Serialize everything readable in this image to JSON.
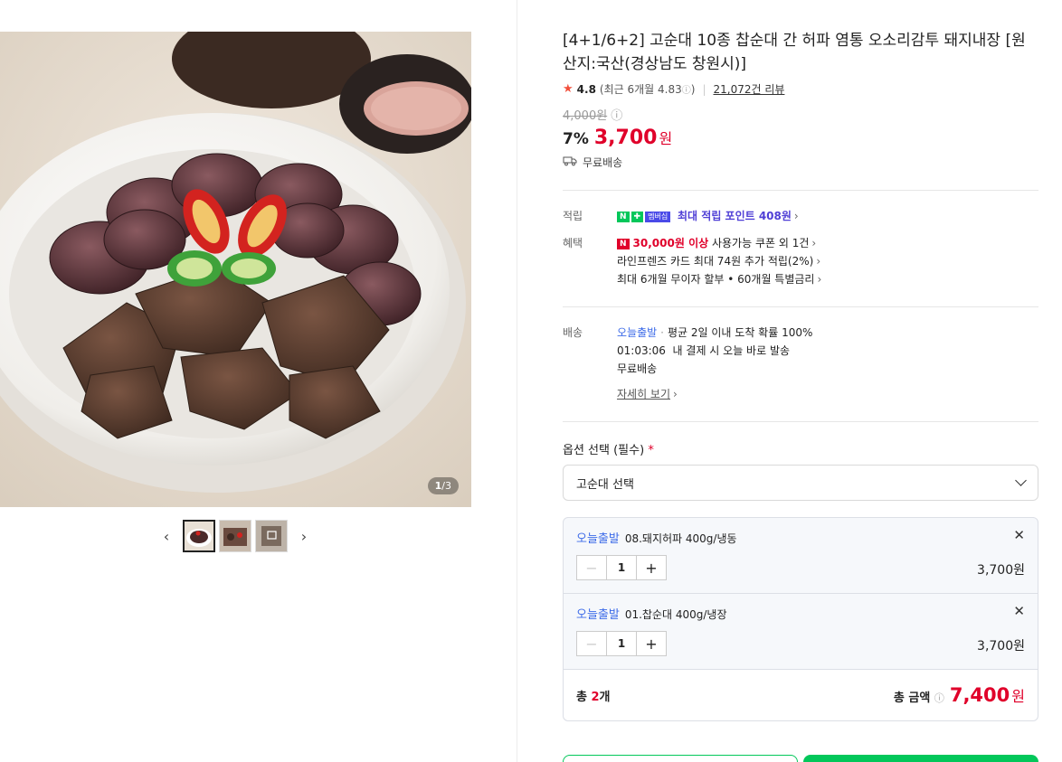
{
  "gallery": {
    "counter_current": "1",
    "counter_total": "/3",
    "prev_arrow": "‹",
    "next_arrow": "›"
  },
  "product": {
    "title": "[4+1/6+2] 고순대 10종 찹순대 간 허파 염통 오소리감투 돼지내장 [원산지:국산(경상남도 창원시)]",
    "rating": "4.8",
    "rating_recent": "(최근 6개월 4.83",
    "rating_recent_close": ")",
    "review_count": "21,072건 리뷰",
    "original_price": "4,000원",
    "discount": "7%",
    "price": "3,700",
    "price_unit": "원",
    "shipping_note": "무료배송"
  },
  "benefits": {
    "points_label": "적립",
    "npay_n": "N",
    "npay_plus": "✚",
    "npay_member": "멤버십",
    "points_text": "최대 적립 포인트 408원",
    "benefit_label": "혜택",
    "coupon_badge": "N",
    "coupon_strong": "30,000원 이상",
    "coupon_text": " 사용가능 쿠폰 외 1건",
    "card_text": "라인프렌즈 카드 최대 74원 추가 적립(2%)",
    "installment_text": "최대 6개월 무이자 할부 • 60개월 특별금리"
  },
  "delivery": {
    "label": "배송",
    "today": "오늘출발",
    "avg_text": "평균 2일 이내 도착 확률 100%",
    "timer": "01:03:06",
    "timer_text": "내 결제 시 오늘 바로 발송",
    "free": "무료배송",
    "detail_link": "자세히 보기"
  },
  "options": {
    "label": "옵션 선택 (필수)",
    "required_mark": "*",
    "select_placeholder": "고순대 선택",
    "items": [
      {
        "tag": "오늘출발",
        "name": "08.돼지허파 400g/냉동",
        "qty": "1",
        "price": "3,700원"
      },
      {
        "tag": "오늘출발",
        "name": "01.찹순대 400g/냉장",
        "qty": "1",
        "price": "3,700원"
      }
    ],
    "total_label_prefix": "총 ",
    "total_count": "2",
    "total_label_suffix": "개",
    "total_amount_label": "총 금액",
    "total_amount": "7,400",
    "total_unit": "원"
  },
  "colors": {
    "price_red": "#e0002a",
    "naver_green": "#03c75a",
    "today_blue": "#3d6be8",
    "points_purple": "#4f3fd6"
  }
}
